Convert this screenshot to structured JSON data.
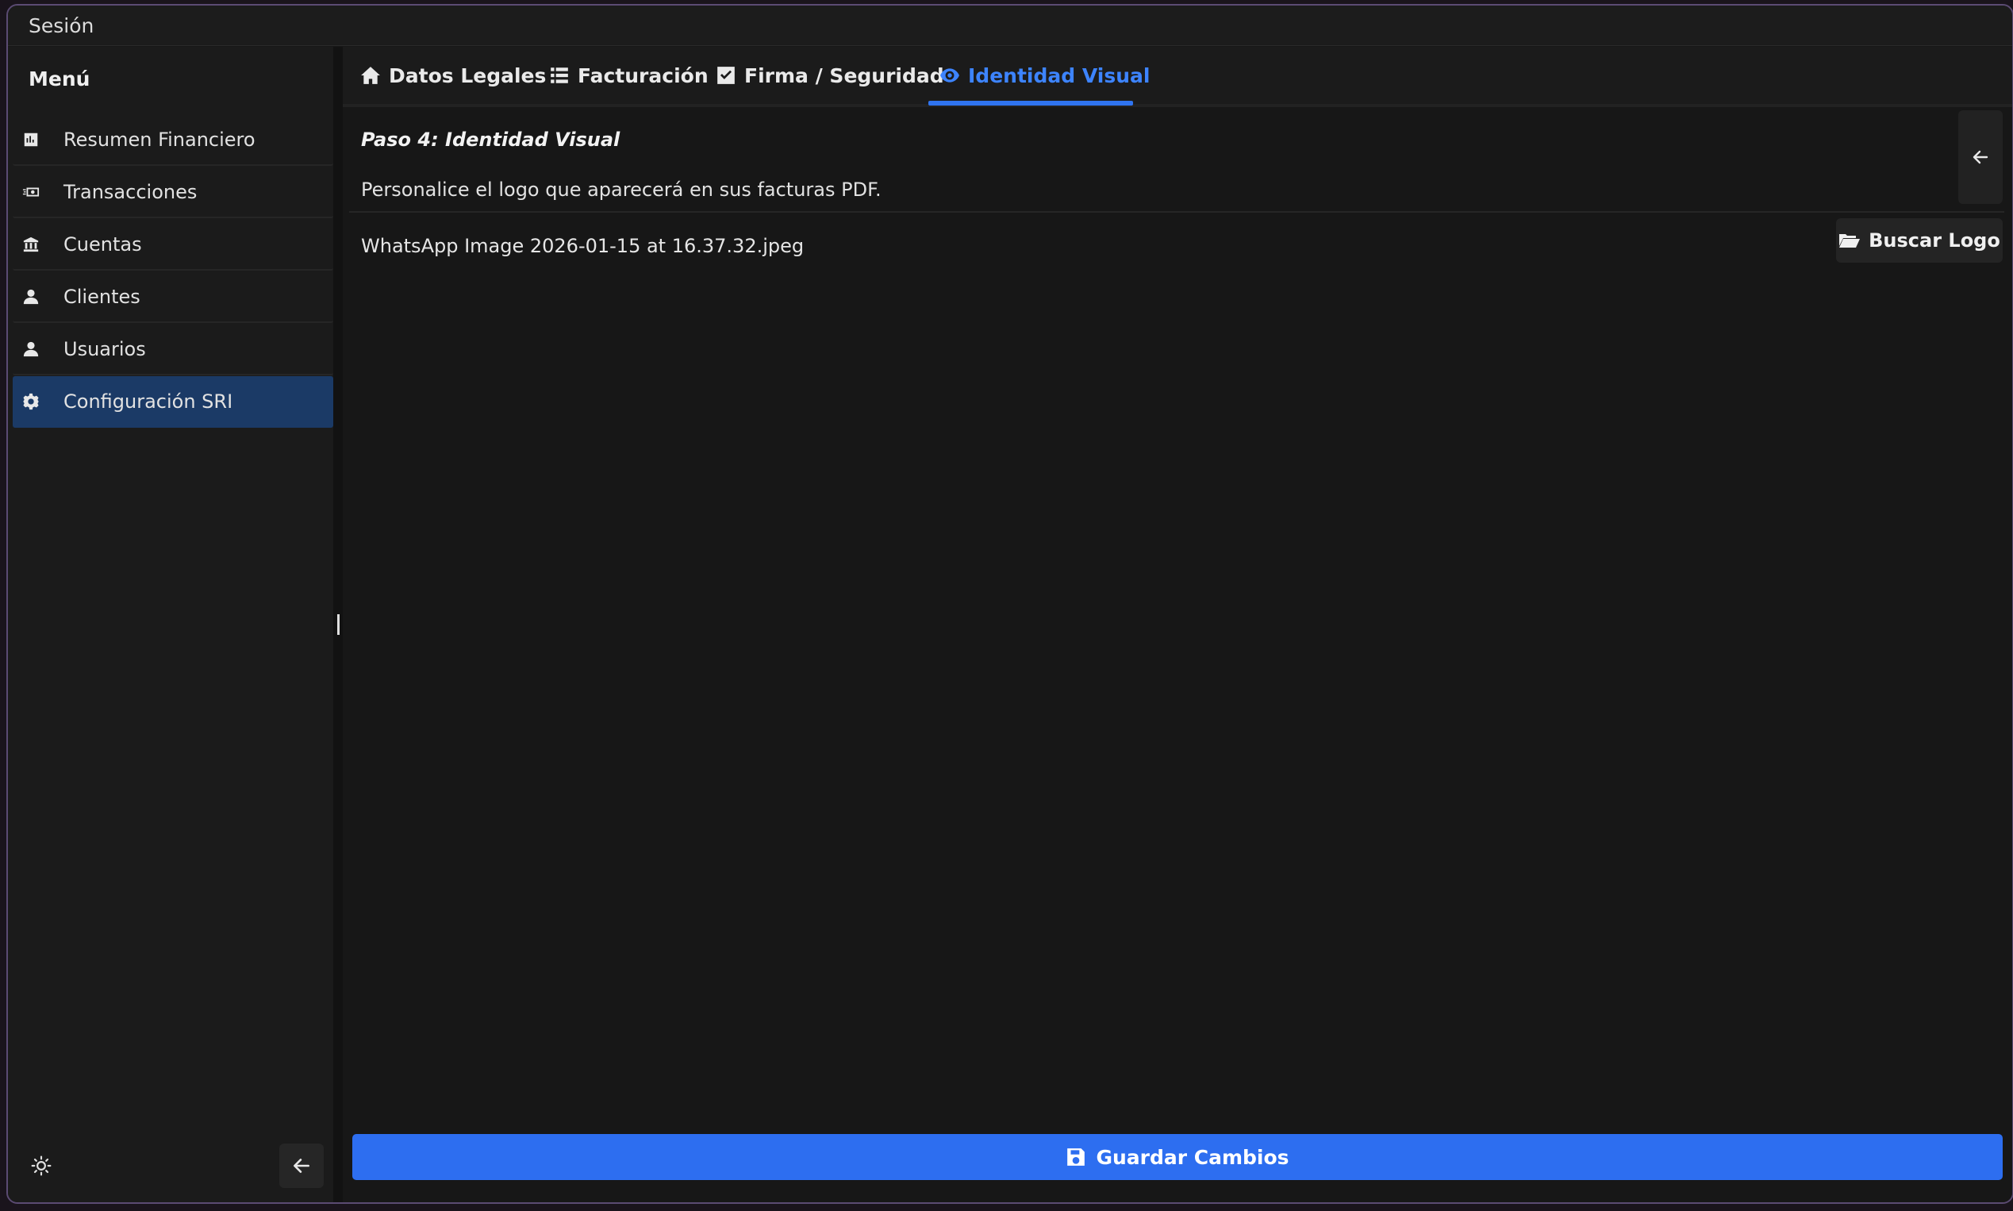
{
  "menubar": {
    "session_label": "Sesión"
  },
  "sidebar": {
    "title": "Menú",
    "items": [
      {
        "label": "Resumen Financiero",
        "icon": "bar-chart-icon",
        "active": false
      },
      {
        "label": "Transacciones",
        "icon": "money-icon",
        "active": false
      },
      {
        "label": "Cuentas",
        "icon": "bank-icon",
        "active": false
      },
      {
        "label": "Clientes",
        "icon": "user-icon",
        "active": false
      },
      {
        "label": "Usuarios",
        "icon": "user-icon",
        "active": false
      },
      {
        "label": "Configuración SRI",
        "icon": "gear-icon",
        "active": true
      }
    ]
  },
  "tabs": [
    {
      "label": "Datos Legales",
      "icon": "home-icon"
    },
    {
      "label": "Facturación",
      "icon": "list-icon"
    },
    {
      "label": "Firma / Seguridad",
      "icon": "checkbox-icon"
    },
    {
      "label": "Identidad Visual",
      "icon": "eye-icon",
      "active": true
    }
  ],
  "content": {
    "step_title": "Paso 4: Identidad Visual",
    "description": "Personalice el logo que aparecerá en sus facturas PDF.",
    "filename": "WhatsApp Image 2026-01-15 at 16.37.32.jpeg",
    "browse_label": "Buscar Logo"
  },
  "footer": {
    "save_label": "Guardar Cambios"
  },
  "colors": {
    "accent": "#2d6ef0",
    "active_nav": "#1b3a66",
    "active_tab": "#3d84ff"
  }
}
